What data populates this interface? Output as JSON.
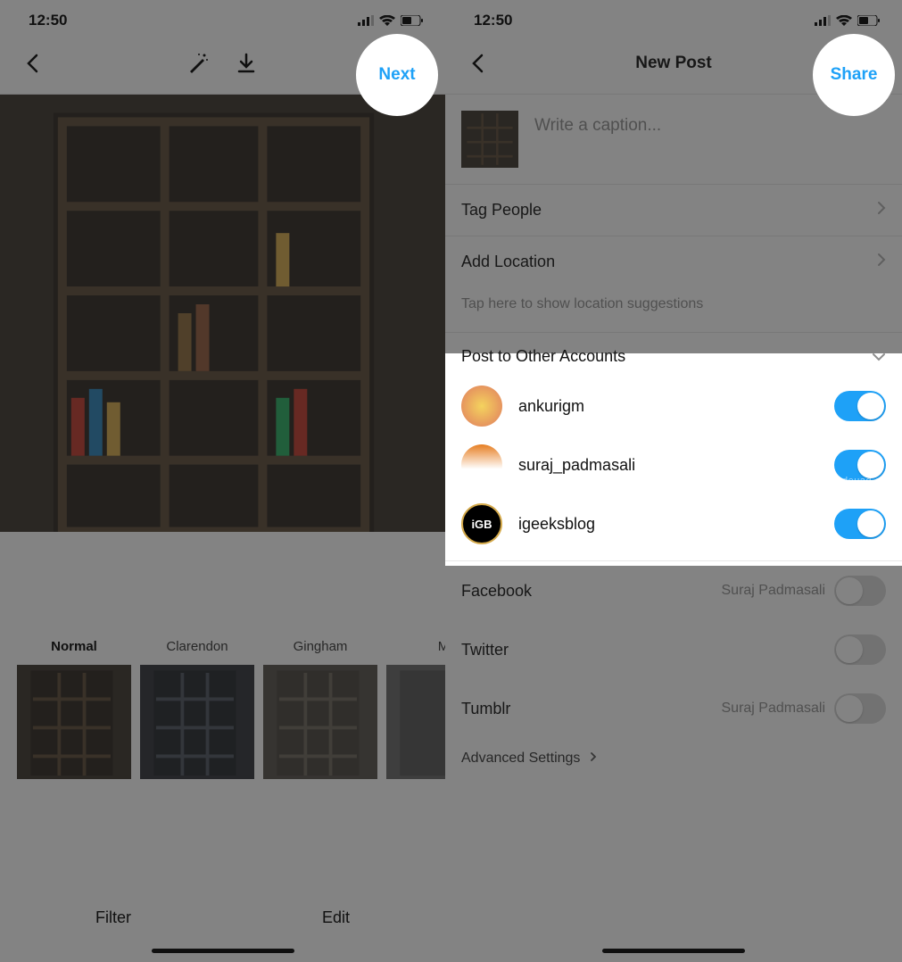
{
  "status": {
    "time": "12:50"
  },
  "left": {
    "next_label": "Next",
    "filters": [
      {
        "label": "Normal"
      },
      {
        "label": "Clarendon"
      },
      {
        "label": "Gingham"
      },
      {
        "label": "M"
      }
    ],
    "tabs": {
      "filter": "Filter",
      "edit": "Edit"
    }
  },
  "right": {
    "title": "New Post",
    "share_label": "Share",
    "caption_placeholder": "Write a caption...",
    "tag_people": "Tag People",
    "add_location": "Add Location",
    "location_hint": "Tap here to show location suggestions",
    "post_other_header": "Post to Other Accounts",
    "accounts": [
      {
        "name": "ankurigm",
        "on": true
      },
      {
        "name": "suraj_padmasali",
        "on": true
      },
      {
        "name": "igeeksblog",
        "on": true
      }
    ],
    "socials": [
      {
        "name": "Facebook",
        "sub": "Suraj Padmasali",
        "on": false
      },
      {
        "name": "Twitter",
        "sub": "",
        "on": false
      },
      {
        "name": "Tumblr",
        "sub": "Suraj Padmasali",
        "on": false
      }
    ],
    "advanced": "Advanced Settings"
  },
  "watermark": "www.deuaq.com"
}
